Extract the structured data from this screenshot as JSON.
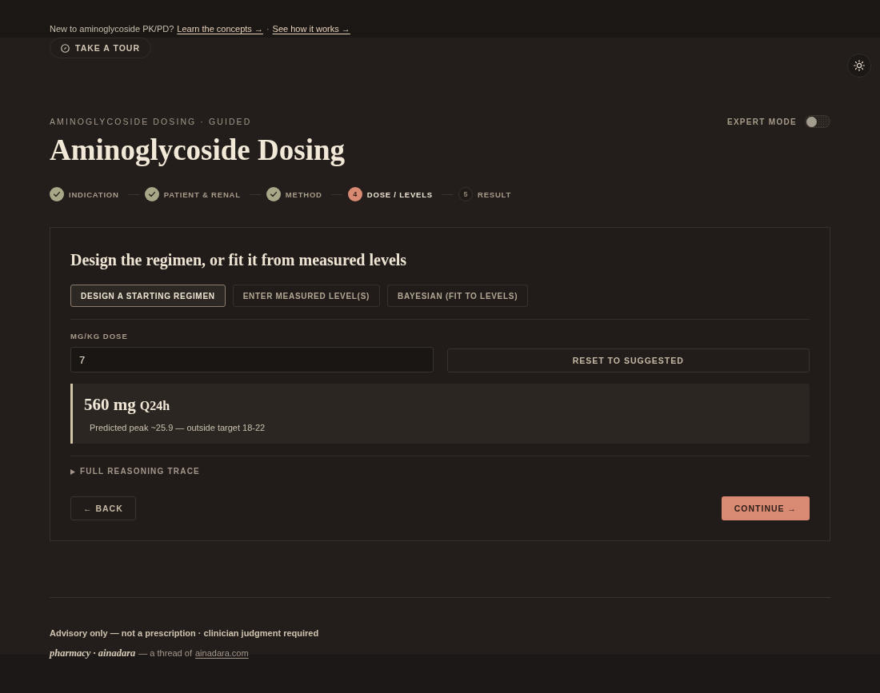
{
  "banner": {
    "text": "New to aminoglycoside PK/PD?",
    "links": [
      "Learn the concepts →",
      "See how it works →"
    ],
    "separator": "·"
  },
  "tour_button": {
    "label": "TAKE A TOUR"
  },
  "header": {
    "eyebrow": "AMINOGLYCOSIDE DOSING · GUIDED",
    "title": "Aminoglycoside Dosing",
    "expert_mode": {
      "label": "EXPERT MODE",
      "on": false
    }
  },
  "steps": [
    {
      "label": "INDICATION",
      "completed": true,
      "active": false
    },
    {
      "label": "PATIENT & RENAL",
      "completed": true,
      "active": false
    },
    {
      "label": "METHOD",
      "completed": true,
      "active": false
    },
    {
      "label": "DOSE / LEVELS",
      "completed": false,
      "active": true,
      "number": "4"
    },
    {
      "label": "RESULT",
      "completed": false,
      "active": false,
      "number": "5"
    }
  ],
  "card": {
    "heading": "Design the regimen, or fit it from measured levels",
    "mode_tabs": [
      {
        "label": "DESIGN A STARTING REGIMEN",
        "selected": true
      },
      {
        "label": "ENTER MEASURED LEVEL(S)",
        "selected": false
      },
      {
        "label": "BAYESIAN (FIT TO LEVELS)",
        "selected": false
      }
    ],
    "dose_field": {
      "label": "MG/KG DOSE",
      "value": "7"
    },
    "reset_button": "RESET TO SUGGESTED",
    "result": {
      "amount": "560 mg",
      "frequency": "Q24h",
      "note": "Predicted peak ~25.9 — outside target 18-22"
    },
    "reasoning_trace": {
      "label": "FULL REASONING TRACE",
      "expanded": false
    },
    "back_button": "← BACK",
    "continue_button": "CONTINUE →"
  },
  "footer": {
    "disclaimer": "Advisory only — not a prescription · clinician judgment required",
    "brand": "pharmacy · ainadara",
    "thread_text": "— a thread of",
    "link": "ainadara.com"
  }
}
